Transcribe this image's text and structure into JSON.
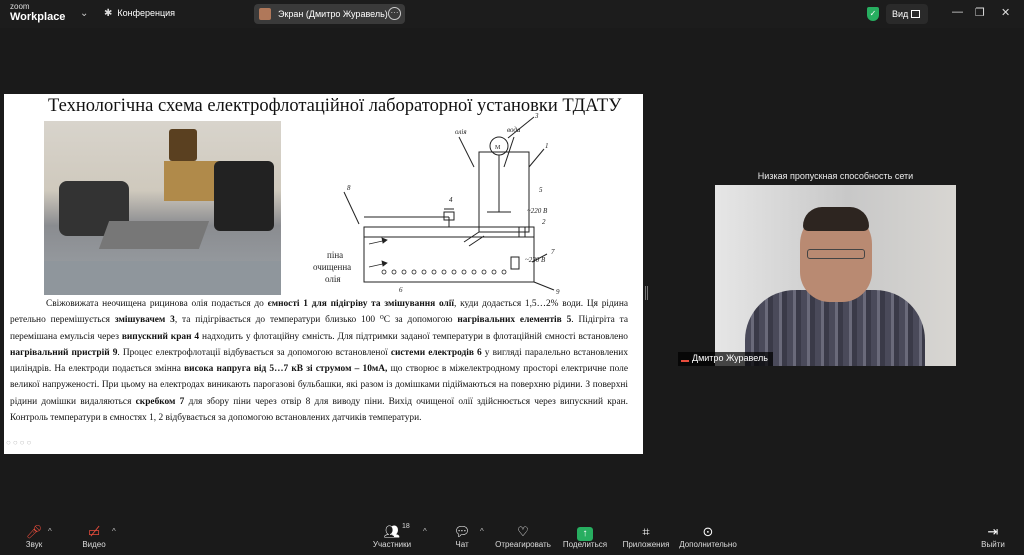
{
  "titlebar": {
    "logo_top": "zoom",
    "logo_bottom": "Workplace",
    "meeting_label": "Конференция",
    "share_label": "Экран (Дмитро Журавель)",
    "view_label": "Вид"
  },
  "slide": {
    "title": "Технологічна схема електрофлотаційної лабораторної установки ТДАТУ",
    "schema_labels": {
      "oil": "олія",
      "water": "вода",
      "n1": "1",
      "n2": "2",
      "n3": "3",
      "n4": "4",
      "n5": "5",
      "n6": "6",
      "n7": "7",
      "n8": "8",
      "n9": "9",
      "v1": "~220 В",
      "v2": "~220 В",
      "foam1": "піна",
      "foam2": "очищенна",
      "foam3": "олія",
      "m": "М"
    },
    "description": [
      {
        "t": "Свіжовижата неочищена рицинова олія подається до ",
        "b": false
      },
      {
        "t": "ємності 1 для підігріву та змішування олії",
        "b": true
      },
      {
        "t": ", куди додається 1,5…2% води. Ця рідина ретельно перемішується ",
        "b": false
      },
      {
        "t": "змішувачем 3",
        "b": true
      },
      {
        "t": ", та підігрівається до температури близько 100 ⁰С за допомогою ",
        "b": false
      },
      {
        "t": "нагрівальних елементів 5",
        "b": true
      },
      {
        "t": ". Підігріта та перемішана емульсія через ",
        "b": false
      },
      {
        "t": "випускний кран 4",
        "b": true
      },
      {
        "t": " надходить у флотаційну ємність. Для підтримки заданої температури в флотаційній ємності встановлено ",
        "b": false
      },
      {
        "t": "нагрівальний пристрій 9",
        "b": true
      },
      {
        "t": ".  Процес електрофлотації відбувається за допомогою встановленої ",
        "b": false
      },
      {
        "t": "системи електродів 6",
        "b": true
      },
      {
        "t": " у вигляді паралельно встановлених циліндрів.  На електроди подається змінна ",
        "b": false
      },
      {
        "t": "висока напруга від 5…7 кВ зі струмом – 10мА,",
        "b": true
      },
      {
        "t": " що створює в міжелектродному просторі електричне поле великої напруженості. При цьому на електродах виникають парогазові бульбашки, які разом із домішками підіймаються на поверхню рідини. З поверхні рідини домішки видаляються ",
        "b": false
      },
      {
        "t": "скребком 7",
        "b": true
      },
      {
        "t": " для збору піни   через отвір 8  для виводу піни. Вихід очищеної олії здійснюється через випускний кран. Контроль температури в ємностях 1, 2 відбувається за допомогою встановлених датчиків температури.",
        "b": false
      }
    ]
  },
  "participant": {
    "net_warning": "Низкая пропускная способность сети",
    "name": "Дмитро Журавель"
  },
  "toolbar": {
    "audio": "Звук",
    "video": "Видео",
    "participants": "Участники",
    "participants_count": "18",
    "chat": "Чат",
    "react": "Отреагировать",
    "share": "Поделиться",
    "apps": "Приложения",
    "more": "Дополнительно",
    "leave": "Выйти"
  },
  "colors": {
    "background": "#1a1a1a",
    "share_green": "#27ae60",
    "leave_red": "#e74c3c"
  }
}
